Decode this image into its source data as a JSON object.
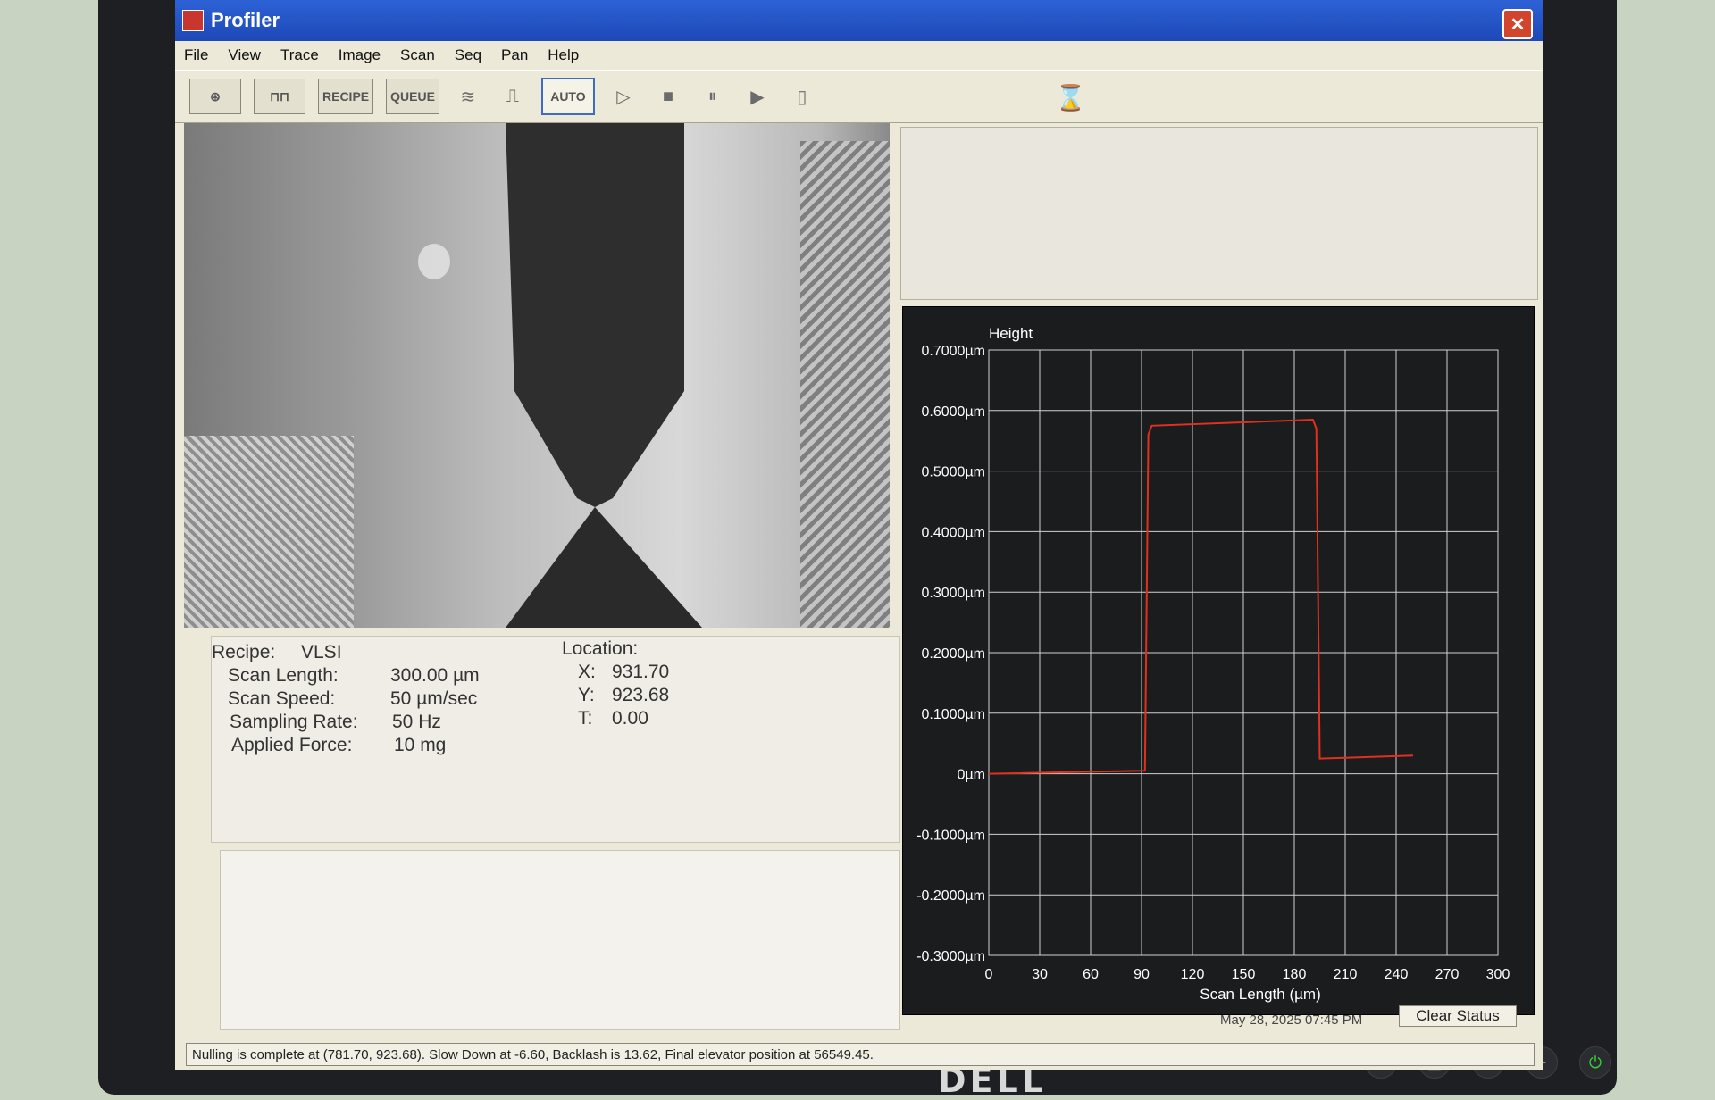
{
  "window": {
    "title": "Profiler"
  },
  "menu": [
    "File",
    "View",
    "Trace",
    "Image",
    "Scan",
    "Seq",
    "Pan",
    "Help"
  ],
  "toolbar": {
    "recipe_label": "RECIPE",
    "queue_label": "QUEUE",
    "auto_label": "AUTO"
  },
  "info": {
    "recipe_label": "Recipe:",
    "recipe_value": "VLSI",
    "scan_length_label": "Scan Length:",
    "scan_length_value": "300.00 µm",
    "scan_speed_label": "Scan Speed:",
    "scan_speed_value": "50 µm/sec",
    "sampling_rate_label": "Sampling Rate:",
    "sampling_rate_value": "50 Hz",
    "applied_force_label": "Applied Force:",
    "applied_force_value": "10 mg",
    "location_label": "Location:",
    "x_label": "X:",
    "x_value": "931.70",
    "y_label": "Y:",
    "y_value": "923.68",
    "t_label": "T:",
    "t_value": "0.00"
  },
  "chart_data": {
    "type": "line",
    "title": "Height",
    "xlabel": "Scan Length (µm)",
    "ylabel": "",
    "xlim": [
      0,
      300
    ],
    "ylim": [
      -0.3,
      0.7
    ],
    "x_ticks": [
      "0",
      "30",
      "60",
      "90",
      "120",
      "150",
      "180",
      "210",
      "240",
      "270",
      "300"
    ],
    "y_ticks": [
      "0.7000µm",
      "0.6000µm",
      "0.5000µm",
      "0.4000µm",
      "0.3000µm",
      "0.2000µm",
      "0.1000µm",
      "0µm",
      "-0.1000µm",
      "-0.2000µm",
      "-0.3000µm"
    ],
    "grid": true,
    "series": [
      {
        "color": "#e0301e",
        "x": [
          0,
          92,
          94,
          96,
          191,
          193,
          195,
          250
        ],
        "y": [
          0.0,
          0.005,
          0.56,
          0.575,
          0.585,
          0.57,
          0.025,
          0.03
        ]
      }
    ]
  },
  "status": {
    "datetime": "May 28, 2025 07:45 PM",
    "clear_label": "Clear Status",
    "message": "Nulling is complete at (781.70, 923.68). Slow Down at -6.60, Backlash is 13.62, Final elevator position at 56549.45."
  },
  "monitor": {
    "brand": "DELL"
  }
}
